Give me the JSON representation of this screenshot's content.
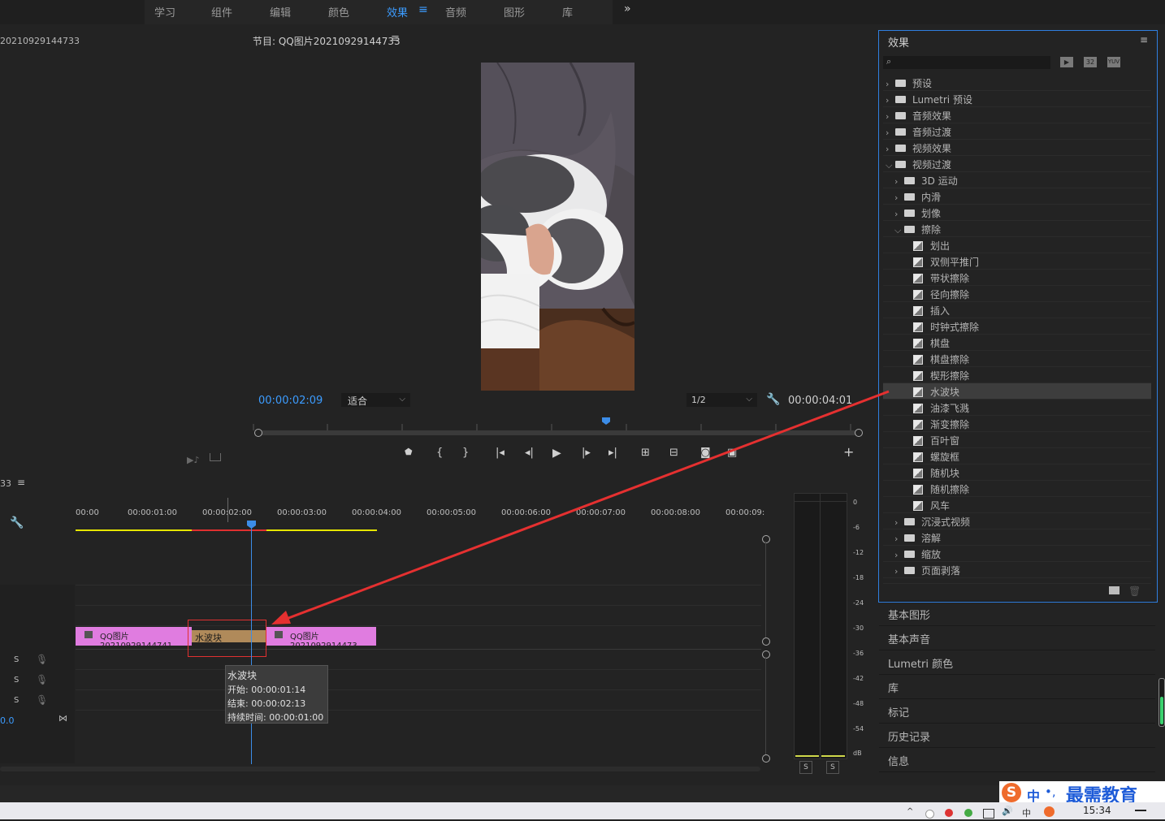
{
  "nav": {
    "items": [
      "学习",
      "组件",
      "编辑",
      "颜色",
      "效果",
      "音频",
      "图形",
      "库"
    ],
    "active": "效果",
    "more": "»"
  },
  "source": {
    "title": "20210929144733"
  },
  "program": {
    "title": "节目: QQ图片20210929144733",
    "current_time": "00:00:02:09",
    "zoom": "适合",
    "resolution": "1/2",
    "duration": "00:00:04:01"
  },
  "timeline": {
    "title": "33",
    "ruler": [
      "00:00",
      "00:00:01:00",
      "00:00:02:00",
      "00:00:03:00",
      "00:00:04:00",
      "00:00:05:00",
      "00:00:06:00",
      "00:00:07:00",
      "00:00:08:00",
      "00:00:09:"
    ],
    "clip1": "QQ图片20210929144741",
    "clip2": "QQ图片2021092914473",
    "transition": "水波块",
    "tooltip": {
      "name": "水波块",
      "start": "开始: 00:00:01:14",
      "end": "结束: 00:00:02:13",
      "duration": "持续时间: 00:00:01:00"
    },
    "audio_solo": "S",
    "audio_value": "0.0"
  },
  "meter": {
    "scale": [
      "0",
      "-6",
      "-12",
      "-18",
      "-24",
      "-30",
      "-36",
      "-42",
      "-48",
      "-54",
      "dB"
    ],
    "solo_left": "S",
    "solo_right": "S"
  },
  "effects": {
    "title": "效果",
    "search_placeholder": "",
    "badges": [
      "32",
      "YUV"
    ],
    "tree": [
      {
        "label": "预设",
        "level": 0,
        "expanded": false,
        "type": "bin"
      },
      {
        "label": "Lumetri 预设",
        "level": 0,
        "expanded": false,
        "type": "bin"
      },
      {
        "label": "音频效果",
        "level": 0,
        "expanded": false,
        "type": "folder"
      },
      {
        "label": "音频过渡",
        "level": 0,
        "expanded": false,
        "type": "folder"
      },
      {
        "label": "视频效果",
        "level": 0,
        "expanded": false,
        "type": "folder"
      },
      {
        "label": "视频过渡",
        "level": 0,
        "expanded": true,
        "type": "folder"
      },
      {
        "label": "3D 运动",
        "level": 1,
        "expanded": false,
        "type": "folder"
      },
      {
        "label": "内滑",
        "level": 1,
        "expanded": false,
        "type": "folder"
      },
      {
        "label": "划像",
        "level": 1,
        "expanded": false,
        "type": "folder"
      },
      {
        "label": "擦除",
        "level": 1,
        "expanded": true,
        "type": "folder"
      },
      {
        "label": "划出",
        "level": 2,
        "type": "fx"
      },
      {
        "label": "双侧平推门",
        "level": 2,
        "type": "fx"
      },
      {
        "label": "带状擦除",
        "level": 2,
        "type": "fx"
      },
      {
        "label": "径向擦除",
        "level": 2,
        "type": "fx"
      },
      {
        "label": "插入",
        "level": 2,
        "type": "fx"
      },
      {
        "label": "时钟式擦除",
        "level": 2,
        "type": "fx"
      },
      {
        "label": "棋盘",
        "level": 2,
        "type": "fx"
      },
      {
        "label": "棋盘擦除",
        "level": 2,
        "type": "fx"
      },
      {
        "label": "楔形擦除",
        "level": 2,
        "type": "fx"
      },
      {
        "label": "水波块",
        "level": 2,
        "type": "fx",
        "selected": true
      },
      {
        "label": "油漆飞溅",
        "level": 2,
        "type": "fx"
      },
      {
        "label": "渐变擦除",
        "level": 2,
        "type": "fx"
      },
      {
        "label": "百叶窗",
        "level": 2,
        "type": "fx"
      },
      {
        "label": "螺旋框",
        "level": 2,
        "type": "fx"
      },
      {
        "label": "随机块",
        "level": 2,
        "type": "fx"
      },
      {
        "label": "随机擦除",
        "level": 2,
        "type": "fx"
      },
      {
        "label": "风车",
        "level": 2,
        "type": "fx"
      },
      {
        "label": "沉浸式视频",
        "level": 1,
        "expanded": false,
        "type": "folder"
      },
      {
        "label": "溶解",
        "level": 1,
        "expanded": false,
        "type": "folder"
      },
      {
        "label": "缩放",
        "level": 1,
        "expanded": false,
        "type": "folder"
      },
      {
        "label": "页面剥落",
        "level": 1,
        "expanded": false,
        "type": "folder"
      }
    ]
  },
  "side_panels": [
    "基本图形",
    "基本声音",
    "Lumetri 颜色",
    "库",
    "标记",
    "历史记录",
    "信息"
  ],
  "watermark": {
    "s": "S",
    "zh": "中",
    "text": "最需教育"
  },
  "taskbar": {
    "time": "15:34"
  },
  "colors": {
    "accent": "#3c9cff",
    "clip": "#e07ce0",
    "transition": "#b08a5a",
    "highlight_box": "#e03030",
    "arrow": "#e53030"
  }
}
